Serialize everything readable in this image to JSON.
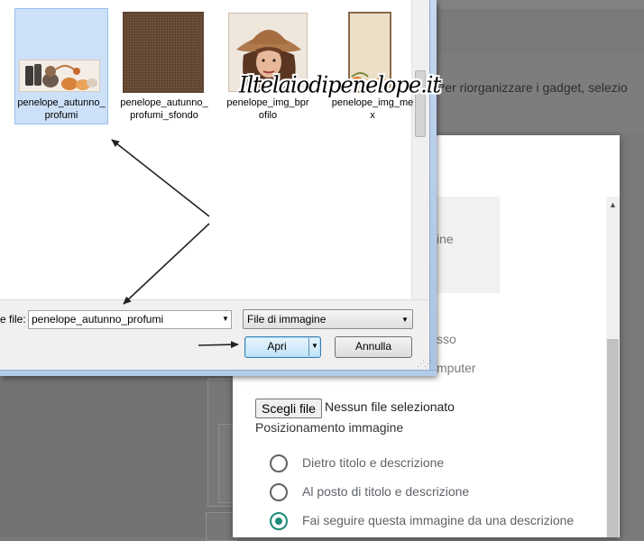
{
  "background": {
    "gadget_hint": "Per riorganizzare i gadget, selezio"
  },
  "blogger_dialog": {
    "image_option_partial": "ine",
    "upload_from_web_partial": "sso",
    "upload_from_computer_partial": "mputer",
    "choose_file_label": "Scegli file",
    "no_file_text": "Nessun file selezionato",
    "placement_heading": "Posizionamento immagine",
    "placement_options": [
      {
        "label": "Dietro titolo e descrizione",
        "selected": false
      },
      {
        "label": "Al posto di titolo e descrizione",
        "selected": false
      },
      {
        "label": "Fai seguire questa immagine da una descrizione",
        "selected": true
      }
    ],
    "accent_color": "#1a8a76"
  },
  "file_dialog": {
    "files": [
      {
        "name": "penelope_autunno_profumi",
        "selected": true,
        "thumb": "autumn-pumpkins-banner"
      },
      {
        "name": "penelope_autunno_profumi_sfondo",
        "selected": false,
        "thumb": "brown-linen-texture"
      },
      {
        "name": "penelope_img_bprofilo",
        "selected": false,
        "thumb": "woman-portrait-hat"
      },
      {
        "name": "penelope_img_mex",
        "selected": false,
        "thumb": "beige-frame-pumpkins"
      }
    ],
    "watermark": "Iltelaiodipenelope.it",
    "filename_label": "e file:",
    "filename_value": "penelope_autunno_profumi",
    "filetype_value": "File di immagine",
    "open_label": "Apri",
    "cancel_label": "Annulla",
    "selection_color": "#cce0f8"
  }
}
